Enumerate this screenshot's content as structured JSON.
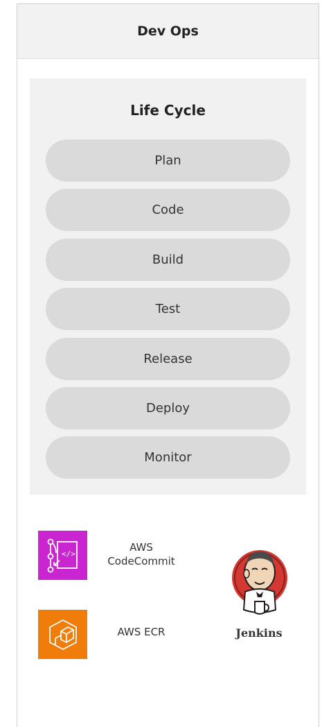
{
  "header": {
    "title": "Dev Ops"
  },
  "lifecycle": {
    "title": "Life Cycle",
    "stages": [
      "Plan",
      "Code",
      "Build",
      "Test",
      "Release",
      "Deploy",
      "Monitor"
    ]
  },
  "tools": {
    "codecommit": {
      "label_line1": "AWS",
      "label_line2": "CodeCommit",
      "icon": "codecommit-icon",
      "color": "#c925d1"
    },
    "ecr": {
      "label": "AWS ECR",
      "icon": "container-icon",
      "color": "#f07d0a"
    },
    "jenkins": {
      "label": "Jenkins",
      "icon": "jenkins-butler-logo"
    }
  }
}
